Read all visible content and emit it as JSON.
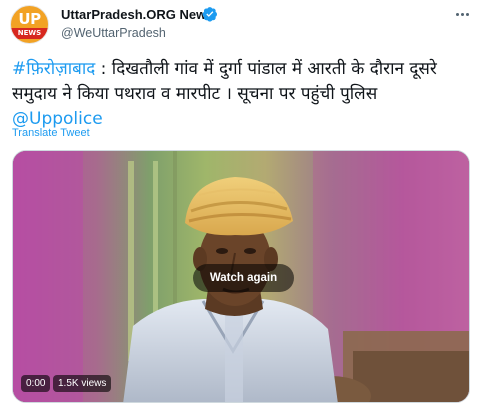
{
  "author": {
    "display_name": "UttarPradesh.ORG News",
    "handle": "@WeUttarPradesh",
    "avatar_text_top": "UP",
    "avatar_text_bottom": "NEWS",
    "verified": true,
    "more_icon": "more-horizontal-icon"
  },
  "tweet": {
    "hashtag": "#फ़िरोज़ाबाद",
    "text": " : दिखतौली गांव में दुर्गा पांडाल में आरती के दौरान दूसरे समुदाय ने किया पथराव व मारपीट । सूचना पर पहुंची पुलिस ",
    "mention": "@Uppolice",
    "translate_label": "Translate Tweet"
  },
  "media": {
    "overlay_label": "Watch again",
    "time": "0:00",
    "views": "1.5K views"
  },
  "colors": {
    "link": "#1d9bf0",
    "verified": "#1d9bf0",
    "text": "#0f1419",
    "secondary": "#536471"
  }
}
